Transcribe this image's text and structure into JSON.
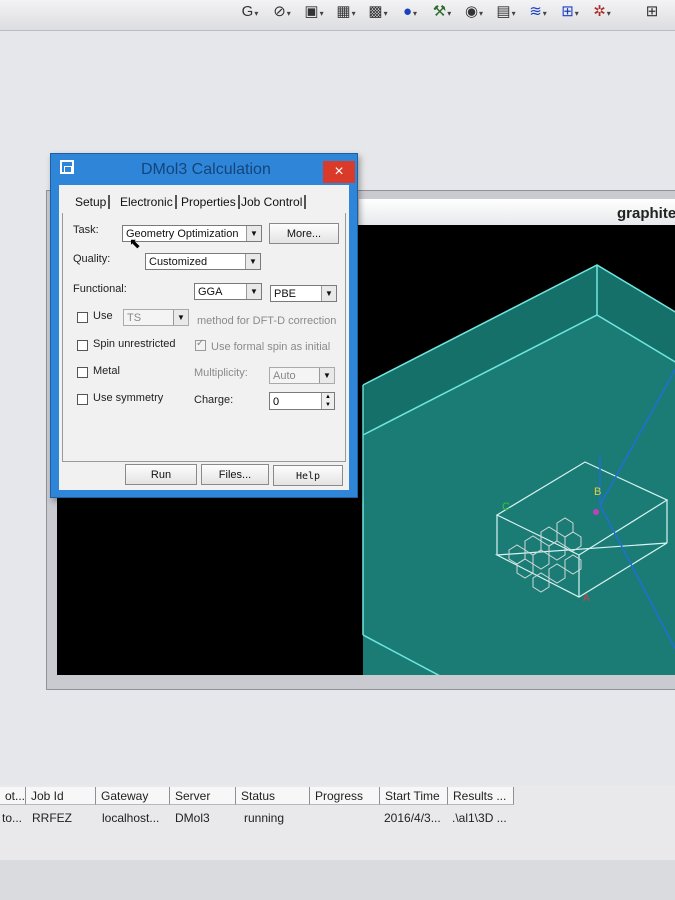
{
  "toolbar": {
    "icons": [
      "g-icon",
      "orbit-icon",
      "scene-icon",
      "grid-icon",
      "lattice-icon",
      "sphere-icon",
      "tools-icon",
      "shape-icon",
      "chart-icon",
      "atoms-icon",
      "settings-icon"
    ]
  },
  "document": {
    "title": "graphite"
  },
  "dialog": {
    "title": "DMol3 Calculation",
    "close": "×",
    "tabs": [
      "Setup",
      "Electronic",
      "Properties",
      "Job Control"
    ],
    "task_label": "Task:",
    "task_value": "Geometry Optimization",
    "more_button": "More...",
    "quality_label": "Quality:",
    "quality_value": "Customized",
    "functional_label": "Functional:",
    "functional_type": "GGA",
    "functional_name": "PBE",
    "use_label": "Use",
    "dft_d_value": "TS",
    "dft_d_text": "method for DFT-D correction",
    "spin_unrestricted_label": "Spin unrestricted",
    "use_formal_spin_label": "Use formal spin as initial",
    "metal_label": "Metal",
    "multiplicity_label": "Multiplicity:",
    "multiplicity_value": "Auto",
    "use_symmetry_label": "Use symmetry",
    "charge_label": "Charge:",
    "charge_value": "0",
    "run_button": "Run",
    "files_button": "Files...",
    "help_button": "Help"
  },
  "viewport": {
    "axis_labels": {
      "a": "A",
      "b": "B",
      "c": "C"
    }
  },
  "jobs": {
    "columns": [
      "ot...",
      "Job Id",
      "Gateway",
      "Server",
      "Status",
      "Progress",
      "Start Time",
      "Results ..."
    ],
    "row": [
      "to...",
      "RRFEZ",
      "localhost...",
      "DMol3",
      "running",
      "",
      "2016/4/3...",
      ".\\al1\\3D ..."
    ]
  },
  "colors": {
    "dialog_frame": "#2f86d8",
    "close_button": "#d93a2a",
    "cell_fill": "#1e7a73",
    "cell_edge": "#6fe6df"
  }
}
